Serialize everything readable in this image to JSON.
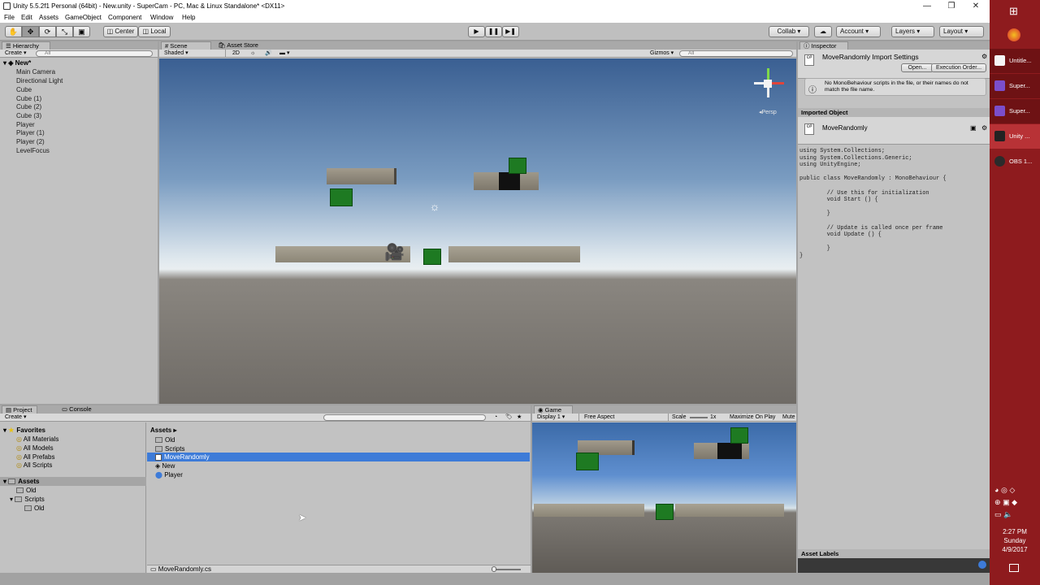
{
  "window": {
    "title": "Unity 5.5.2f1 Personal (64bit) - New.unity - SuperCam - PC, Mac & Linux Standalone* <DX11>"
  },
  "menu": [
    "File",
    "Edit",
    "Assets",
    "GameObject",
    "Component",
    "Window",
    "Help"
  ],
  "toolbar": {
    "pivot": "Center",
    "space": "Local",
    "collab": "Collab ▾",
    "account": "Account",
    "layers": "Layers",
    "layout": "Layout"
  },
  "hierarchy": {
    "tab": "Hierarchy",
    "create": "Create ▾",
    "search": "All",
    "scene": "New*",
    "items": [
      "Main Camera",
      "Directional Light",
      "Cube",
      "Cube (1)",
      "Cube (2)",
      "Cube (3)",
      "Player",
      "Player (1)",
      "Player (2)",
      "LevelFocus"
    ]
  },
  "scene": {
    "tab_scene": "Scene",
    "tab_store": "Asset Store",
    "shading": "Shaded",
    "mode2d": "2D",
    "gizmos": "Gizmos ▾",
    "search": "All",
    "persp": "Persp"
  },
  "inspector": {
    "tab": "Inspector",
    "title": "MoveRandomly Import Settings",
    "open": "Open...",
    "exec_order": "Execution Order...",
    "warning": "No MonoBehaviour scripts in the file, or their names do not match the file name.",
    "imported_object": "Imported Object",
    "object_name": "MoveRandomly",
    "code": "using System.Collections;\nusing System.Collections.Generic;\nusing UnityEngine;\n\npublic class MoveRandomly : MonoBehaviour {\n\n\t// Use this for initialization\n\tvoid Start () {\n\t\t\n\t}\n\t\n\t// Update is called once per frame\n\tvoid Update () {\n\t\t\n\t}\n}",
    "asset_labels": "Asset Labels"
  },
  "project": {
    "tab_project": "Project",
    "tab_console": "Console",
    "create": "Create ▾",
    "favorites": "Favorites",
    "fav_items": [
      "All Materials",
      "All Models",
      "All Prefabs",
      "All Scripts"
    ],
    "assets": "Assets",
    "tree_old": "Old",
    "tree_scripts": "Scripts",
    "tree_scripts_old": "Old",
    "breadcrumb": "Assets ▸",
    "files": [
      "Old",
      "Scripts",
      "MoveRandomly",
      "New",
      "Player"
    ],
    "status_file": "MoveRandomly.cs"
  },
  "game": {
    "tab": "Game",
    "display": "Display 1",
    "aspect": "Free Aspect",
    "scale_label": "Scale",
    "scale": "1x",
    "maximize": "Maximize On Play",
    "mute": "Mute"
  },
  "taskbar": {
    "apps": [
      "Untitle...",
      "Super...",
      "Super...",
      "Unity ...",
      "OBS 1..."
    ],
    "time": "2:27 PM",
    "day": "Sunday",
    "date": "4/9/2017"
  },
  "colors": {
    "selection": "#3d7bd8",
    "taskbar": "#8e1b1e",
    "cube_green": "#1e7a22"
  }
}
